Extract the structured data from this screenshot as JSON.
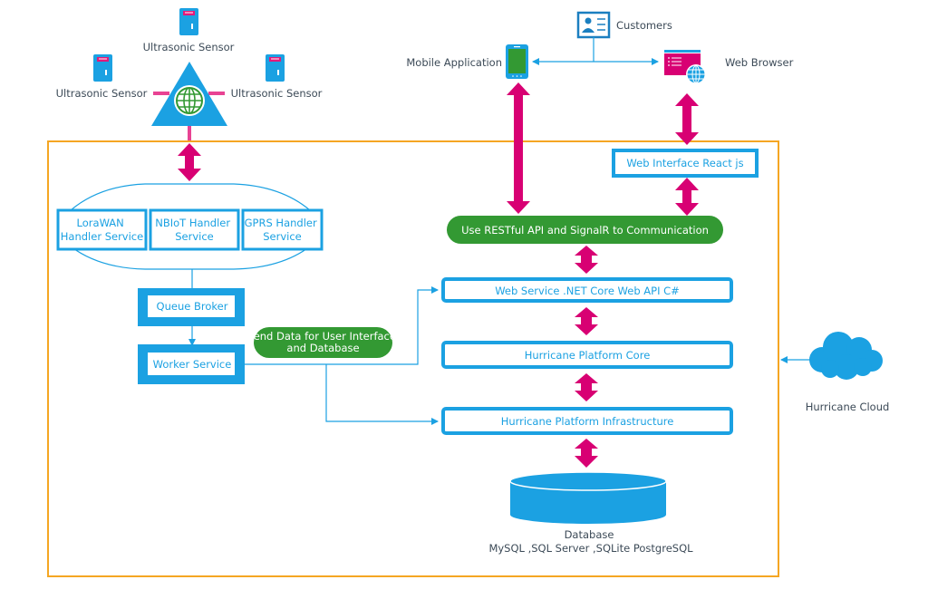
{
  "colors": {
    "blue": "#1ba1e2",
    "magenta": "#d80073",
    "green": "#339933",
    "orange": "#f5a623",
    "text": "#3c4a57"
  },
  "sensors": {
    "top_label": "Ultrasonic Sensor",
    "left_label": "Ultrasonic Sensor",
    "right_label": "Ultrasonic Sensor",
    "icon": "ultrasonic-sensor-icon",
    "gateway_icon": "gateway-globe-icon"
  },
  "clients": {
    "customers_label": "Customers",
    "mobile_label": "Mobile Application",
    "browser_label": "Web Browser"
  },
  "handlers": {
    "lorawan": [
      "LoraWAN",
      "Handler Service"
    ],
    "nbiot": [
      "NBIoT Handler",
      "Service"
    ],
    "gprs": [
      "GPRS Handler",
      "Service"
    ]
  },
  "queue_broker": "Queue Broker",
  "worker_service": "Worker Service",
  "send_data": [
    "Send Data for User Interface",
    "and Database"
  ],
  "web_interface": "Web Interface React js",
  "restful": "Use RESTful API and SignalR to Communication",
  "web_service": "Web Service .NET Core Web API C#",
  "platform_core": "Hurricane Platform Core",
  "platform_infra": "Hurricane Platform Infrastructure",
  "database": {
    "title": "Database",
    "engines": "MySQL ,SQL Server ,SQLite  PostgreSQL"
  },
  "cloud_label": "Hurricane Cloud"
}
